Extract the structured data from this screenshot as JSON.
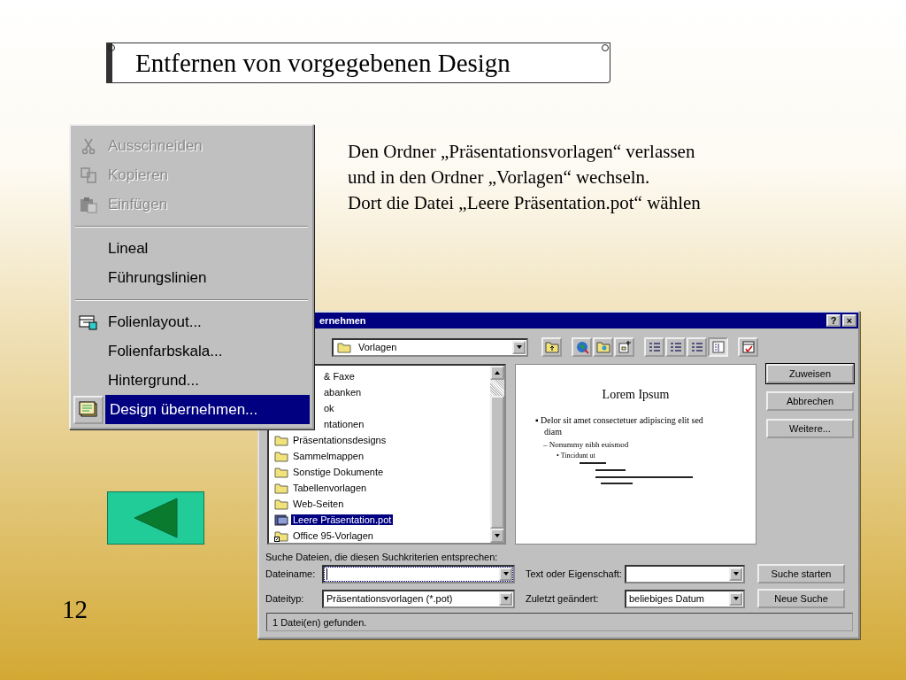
{
  "slide": {
    "title": "Entfernen von vorgegebenen Design",
    "text": [
      "Den Ordner „Präsentationsvorlagen“ verlassen",
      "und in den Ordner „Vorlagen“ wechseln.",
      "Dort die Datei „Leere Präsentation.pot“ wählen"
    ],
    "page_number": "12"
  },
  "menu": {
    "groups": [
      [
        {
          "label": "Ausschneiden",
          "kind": "cut",
          "disabled": true,
          "selected": false
        },
        {
          "label": "Kopieren",
          "kind": "copy",
          "disabled": true,
          "selected": false
        },
        {
          "label": "Einfügen",
          "kind": "paste",
          "disabled": true,
          "selected": false
        }
      ],
      [
        {
          "label": "Lineal",
          "kind": "plain",
          "disabled": false,
          "selected": false
        },
        {
          "label": "Führungslinien",
          "kind": "plain",
          "disabled": false,
          "selected": false
        }
      ],
      [
        {
          "label": "Folienlayout...",
          "kind": "layout",
          "disabled": false,
          "selected": false
        },
        {
          "label": "Folienfarbskala...",
          "kind": "plain",
          "disabled": false,
          "selected": false
        },
        {
          "label": "Hintergrund...",
          "kind": "plain",
          "disabled": false,
          "selected": false
        },
        {
          "label": "Design übernehmen...",
          "kind": "design",
          "disabled": false,
          "selected": true
        }
      ]
    ]
  },
  "dialog": {
    "title": "ernehmen",
    "title_buttons": [
      "?",
      "×"
    ],
    "look_in": "Vorlagen",
    "toolbar": [
      {
        "selected": false
      },
      {
        "selected": false
      },
      {
        "selected": false
      },
      {
        "selected": false
      },
      {
        "selected": false
      },
      {
        "selected": false
      },
      {
        "selected": false
      },
      {
        "selected": true
      },
      {
        "selected": false
      }
    ],
    "files": [
      {
        "name": "& Faxe",
        "kind": "clipped"
      },
      {
        "name": "abanken",
        "kind": "clipped"
      },
      {
        "name": "ok",
        "kind": "clipped"
      },
      {
        "name": "ntationen",
        "kind": "clipped"
      },
      {
        "name": "Präsentationsdesigns",
        "kind": "folder",
        "selected": false
      },
      {
        "name": "Sammelmappen",
        "kind": "folder",
        "selected": false
      },
      {
        "name": "Sonstige Dokumente",
        "kind": "folder",
        "selected": false
      },
      {
        "name": "Tabellenvorlagen",
        "kind": "folder",
        "selected": false
      },
      {
        "name": "Web-Seiten",
        "kind": "folder",
        "selected": false
      },
      {
        "name": "Leere Präsentation.pot",
        "kind": "file",
        "selected": true
      },
      {
        "name": "Office 95-Vorlagen",
        "kind": "shortcut",
        "selected": false
      }
    ],
    "preview": {
      "title": "Lorem Ipsum",
      "lines": [
        {
          "text": "▪ Delor sit amet consectetuer adipiscing elit sed diam",
          "kind": "bullet"
        },
        {
          "text": "– Nonummy nibh euismod",
          "kind": "dash"
        },
        {
          "text": "• Tincidunt ut",
          "kind": "dot"
        }
      ]
    },
    "buttons": [
      "Zuweisen",
      "Abbrechen",
      "Weitere..."
    ],
    "search": {
      "caption": "Suche Dateien, die diesen Suchkriterien entsprechen:",
      "fields": [
        {
          "label": "Dateiname:",
          "focused": true
        },
        {
          "label": "Text oder Eigenschaft:",
          "focused": false
        },
        {
          "label": "Dateityp:",
          "value": "Präsentationsvorlagen (*.pot)",
          "focused": false
        },
        {
          "label": "Zuletzt geändert:",
          "value": "beliebiges Datum",
          "focused": false
        }
      ],
      "buttons": [
        "Suche starten",
        "Neue Suche"
      ]
    },
    "status": "1 Datei(en) gefunden."
  }
}
